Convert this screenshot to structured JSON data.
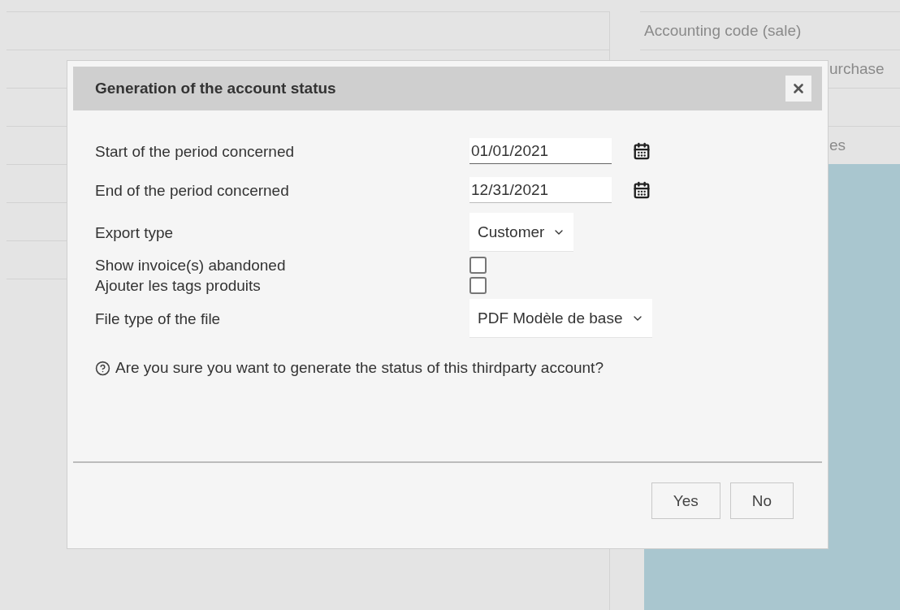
{
  "background": {
    "right_column": [
      {
        "text": "Accounting code (sale)",
        "cut": false
      },
      {
        "text": "urchase",
        "cut": true
      },
      {
        "text": "es",
        "cut": true
      }
    ]
  },
  "dialog": {
    "title": "Generation of the account status",
    "fields": [
      {
        "kind": "date",
        "label": "Start of the period concerned",
        "value": "01/01/2021",
        "focused": true
      },
      {
        "kind": "date",
        "label": "End of the period concerned",
        "value": "12/31/2021",
        "focused": false
      },
      {
        "kind": "select",
        "label": "Export type",
        "value": "Customer"
      },
      {
        "kind": "checkbox",
        "label": "Show invoice(s) abandoned",
        "checked": false
      },
      {
        "kind": "checkbox",
        "label": "Ajouter les tags produits",
        "checked": false
      },
      {
        "kind": "select",
        "label": "File type of the file",
        "value": "PDF Modèle de base"
      }
    ],
    "question": "Are you sure you want to generate the status of this thirdparty account?",
    "buttons": [
      "Yes",
      "No"
    ]
  }
}
